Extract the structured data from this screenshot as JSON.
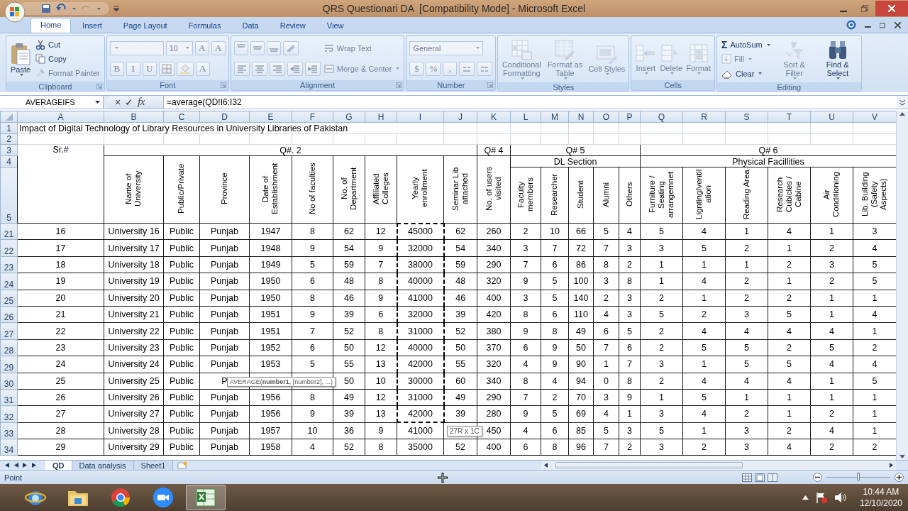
{
  "window": {
    "title": "QRS Questionari DA  [Compatibility Mode] - Microsoft Excel"
  },
  "ribbon": {
    "tabs": [
      {
        "label": "Home",
        "selected": true
      },
      {
        "label": "Insert",
        "selected": false
      },
      {
        "label": "Page Layout",
        "selected": false
      },
      {
        "label": "Formulas",
        "selected": false
      },
      {
        "label": "Data",
        "selected": false
      },
      {
        "label": "Review",
        "selected": false
      },
      {
        "label": "View",
        "selected": false
      }
    ],
    "groups": [
      {
        "label": "Clipboard",
        "launcher": true,
        "columns": [
          [
            {
              "kind": "large",
              "label": "Paste",
              "disabled": false,
              "dropdown": true
            }
          ],
          [
            {
              "kind": "small",
              "label": "Cut",
              "disabled": false
            },
            {
              "kind": "small",
              "label": "Copy",
              "disabled": false
            },
            {
              "kind": "small",
              "label": "Format Painter",
              "disabled": true
            }
          ]
        ]
      },
      {
        "label": "Font",
        "launcher": true,
        "columns": [
          [
            {
              "kind": "toolrow",
              "tools": [
                {
                  "kind": "field",
                  "disabled": true
                },
                {
                  "kind": "field",
                  "value": "10",
                  "disabled": true
                },
                {
                  "kind": "button",
                  "label": "A",
                  "disabled": true
                },
                {
                  "kind": "button",
                  "label": "A",
                  "disabled": true
                }
              ]
            },
            {
              "kind": "toolrow",
              "tools": [
                {
                  "kind": "button",
                  "label": "B",
                  "disabled": true
                },
                {
                  "kind": "button",
                  "label": "I",
                  "disabled": true
                },
                {
                  "kind": "button",
                  "label": "U",
                  "disabled": true
                },
                {
                  "kind": "button",
                  "disabled": true
                },
                {
                  "kind": "button",
                  "disabled": true
                },
                {
                  "kind": "button",
                  "label": "A",
                  "disabled": true
                }
              ]
            }
          ]
        ]
      },
      {
        "label": "Alignment",
        "launcher": true,
        "columns": [
          [
            {
              "kind": "toolrow",
              "tools": [
                {
                  "kind": "button",
                  "disabled": true
                },
                {
                  "kind": "button",
                  "disabled": true
                },
                {
                  "kind": "button",
                  "disabled": true
                },
                {
                  "kind": "button",
                  "disabled": true
                }
              ]
            },
            {
              "kind": "toolrow",
              "tools": [
                {
                  "kind": "button",
                  "disabled": true
                },
                {
                  "kind": "button",
                  "disabled": true
                },
                {
                  "kind": "button",
                  "disabled": true
                },
                {
                  "kind": "button",
                  "disabled": true
                },
                {
                  "kind": "button",
                  "disabled": true
                }
              ]
            }
          ],
          [
            {
              "kind": "small",
              "label": "Wrap Text",
              "disabled": true
            },
            {
              "kind": "small",
              "label": "Merge & Center",
              "disabled": true,
              "dropdown": true
            }
          ]
        ]
      },
      {
        "label": "Number",
        "launcher": true,
        "columns": [
          [
            {
              "kind": "toolrow",
              "tools": [
                {
                  "kind": "field",
                  "value": "General",
                  "disabled": true
                }
              ]
            },
            {
              "kind": "toolrow",
              "tools": [
                {
                  "kind": "button",
                  "label": "$",
                  "disabled": true
                },
                {
                  "kind": "button",
                  "label": "%",
                  "disabled": true
                },
                {
                  "kind": "button",
                  "label": ",",
                  "disabled": true
                },
                {
                  "kind": "button",
                  "disabled": true
                },
                {
                  "kind": "button",
                  "disabled": true
                }
              ]
            }
          ]
        ]
      },
      {
        "label": "Styles",
        "launcher": false,
        "columns": [
          [
            {
              "kind": "large",
              "label": "Conditional Formatting",
              "disabled": true,
              "dropdown": true
            }
          ],
          [
            {
              "kind": "large",
              "label": "Format as Table",
              "disabled": true,
              "dropdown": true
            }
          ],
          [
            {
              "kind": "large",
              "label": "Cell Styles",
              "disabled": true,
              "dropdown": true
            }
          ]
        ]
      },
      {
        "label": "Cells",
        "launcher": false,
        "columns": [
          [
            {
              "kind": "large",
              "label": "Insert",
              "disabled": true,
              "dropdown": true
            }
          ],
          [
            {
              "kind": "large",
              "label": "Delete",
              "disabled": true,
              "dropdown": true
            }
          ],
          [
            {
              "kind": "large",
              "label": "Format",
              "disabled": true,
              "dropdown": true
            }
          ]
        ]
      },
      {
        "label": "Editing",
        "launcher": false,
        "columns": [
          [
            {
              "kind": "small",
              "glyph": "Σ",
              "label": "AutoSum",
              "disabled": false,
              "dropdown": true
            },
            {
              "kind": "small",
              "label": "Fill",
              "disabled": true,
              "dropdown": true
            },
            {
              "kind": "small",
              "label": "Clear",
              "disabled": false,
              "dropdown": true
            }
          ],
          [
            {
              "kind": "large",
              "label": "Sort & Filter",
              "disabled": true,
              "dropdown": true
            }
          ],
          [
            {
              "kind": "large",
              "label": "Find & Select",
              "disabled": false,
              "dropdown": true
            }
          ]
        ]
      }
    ]
  },
  "formula_bar": {
    "name_box": "AVERAGEIFS",
    "cancel": "×",
    "enter": "✓",
    "function": "fx",
    "formula": "=average(QD!I6:I32"
  },
  "sheet": {
    "columns": [
      "A",
      "B",
      "C",
      "D",
      "E",
      "F",
      "G",
      "H",
      "I",
      "J",
      "K",
      "L",
      "M",
      "N",
      "O",
      "P",
      "Q",
      "R",
      "S",
      "T",
      "U",
      "V"
    ],
    "header_rows": [
      "1",
      "2",
      "3",
      "4",
      "5"
    ],
    "title": "Impact of Digital Technology of Library Resources in University Libraries of Pakistan",
    "groups": [
      {
        "label": "Sr.#"
      },
      {
        "label": "Q#. 2"
      },
      {
        "label": "Q# 4"
      },
      {
        "label": "Q# 5"
      },
      {
        "label": "Q# 6"
      }
    ],
    "subgroups": [
      {
        "label": "DL Section"
      },
      {
        "label": "Physical Facillities"
      }
    ],
    "column_headings": [
      "Name of University",
      "Public/Private",
      "Province",
      "Date of Establishment",
      "No of faculties",
      "No. of Department",
      "Affiliated Colleges",
      "Yearly enrollment",
      "Seminar Lib attached",
      "No. of users visited",
      "Faculty members",
      "Researcher",
      "Student",
      "Alumni",
      "Others",
      "Furniture / Seating arrangemnet",
      "Lignting/ventil ation",
      "Reading Area",
      "Research Cubicles / Cabine",
      "Air Conditioning",
      "Lib. Building (Safety Aspects)"
    ],
    "rows": [
      {
        "header": "21",
        "referenced": true,
        "cells": [
          "16",
          "University 16",
          "Public",
          "Punjab",
          "1947",
          "8",
          "62",
          "12",
          "45000",
          "62",
          "260",
          "2",
          "10",
          "66",
          "5",
          "4",
          "5",
          "4",
          "1",
          "4",
          "1",
          "3"
        ]
      },
      {
        "header": "22",
        "referenced": true,
        "cells": [
          "17",
          "University 17",
          "Public",
          "Punjab",
          "1948",
          "9",
          "54",
          "9",
          "32000",
          "54",
          "340",
          "3",
          "7",
          "72",
          "7",
          "3",
          "3",
          "5",
          "2",
          "1",
          "2",
          "4"
        ]
      },
      {
        "header": "23",
        "referenced": true,
        "cells": [
          "18",
          "University 18",
          "Public",
          "Punjab",
          "1949",
          "5",
          "59",
          "7",
          "38000",
          "59",
          "290",
          "7",
          "6",
          "86",
          "8",
          "2",
          "1",
          "1",
          "1",
          "2",
          "3",
          "5"
        ]
      },
      {
        "header": "24",
        "referenced": true,
        "cells": [
          "19",
          "University 19",
          "Public",
          "Punjab",
          "1950",
          "6",
          "48",
          "8",
          "40000",
          "48",
          "320",
          "9",
          "5",
          "100",
          "3",
          "8",
          "1",
          "4",
          "2",
          "1",
          "2",
          "5"
        ]
      },
      {
        "header": "25",
        "referenced": true,
        "cells": [
          "20",
          "University 20",
          "Public",
          "Punjab",
          "1950",
          "8",
          "46",
          "9",
          "41000",
          "46",
          "400",
          "3",
          "5",
          "140",
          "2",
          "3",
          "2",
          "1",
          "2",
          "2",
          "1",
          "1"
        ]
      },
      {
        "header": "26",
        "referenced": true,
        "cells": [
          "21",
          "University 21",
          "Public",
          "Punjab",
          "1951",
          "9",
          "39",
          "6",
          "32000",
          "39",
          "420",
          "8",
          "6",
          "110",
          "4",
          "3",
          "5",
          "2",
          "3",
          "5",
          "1",
          "4"
        ]
      },
      {
        "header": "27",
        "referenced": true,
        "cells": [
          "22",
          "University 22",
          "Public",
          "Punjab",
          "1951",
          "7",
          "52",
          "8",
          "31000",
          "52",
          "380",
          "9",
          "8",
          "49",
          "6",
          "5",
          "2",
          "4",
          "4",
          "4",
          "4",
          "1"
        ]
      },
      {
        "header": "28",
        "referenced": true,
        "cells": [
          "23",
          "University 23",
          "Public",
          "Punjab",
          "1952",
          "6",
          "50",
          "12",
          "40000",
          "50",
          "370",
          "6",
          "9",
          "50",
          "7",
          "6",
          "2",
          "5",
          "5",
          "2",
          "5",
          "2"
        ]
      },
      {
        "header": "29",
        "referenced": true,
        "cells": [
          "24",
          "University 24",
          "Public",
          "Punjab",
          "1953",
          "5",
          "55",
          "13",
          "42000",
          "55",
          "320",
          "4",
          "9",
          "90",
          "1",
          "7",
          "3",
          "1",
          "5",
          "5",
          "4",
          "4"
        ]
      },
      {
        "header": "30",
        "referenced": true,
        "cells": [
          "25",
          "University 25",
          "Public",
          "P",
          null,
          null,
          "50",
          "10",
          "30000",
          "60",
          "340",
          "8",
          "4",
          "94",
          "0",
          "8",
          "2",
          "4",
          "4",
          "4",
          "1",
          "5"
        ]
      },
      {
        "header": "31",
        "referenced": true,
        "cells": [
          "26",
          "University 26",
          "Public",
          "Punjab",
          "1956",
          "8",
          "49",
          "12",
          "31000",
          "49",
          "290",
          "7",
          "2",
          "70",
          "3",
          "9",
          "1",
          "5",
          "1",
          "1",
          "1",
          "1"
        ]
      },
      {
        "header": "32",
        "referenced": true,
        "cells": [
          "27",
          "University 27",
          "Public",
          "Punjab",
          "1956",
          "9",
          "39",
          "13",
          "42000",
          "39",
          "280",
          "9",
          "5",
          "69",
          "4",
          "1",
          "3",
          "4",
          "2",
          "1",
          "2",
          "1"
        ]
      },
      {
        "header": "33",
        "referenced": false,
        "cells": [
          "28",
          "University 28",
          "Public",
          "Punjab",
          "1957",
          "10",
          "36",
          "9",
          "41000",
          null,
          "450",
          "4",
          "6",
          "85",
          "5",
          "3",
          "5",
          "1",
          "3",
          "2",
          "4",
          "1"
        ]
      },
      {
        "header": "34",
        "referenced": false,
        "cells": [
          "29",
          "University 29",
          "Public",
          "Punjab",
          "1958",
          "4",
          "52",
          "8",
          "35000",
          "52",
          "400",
          "6",
          "8",
          "96",
          "7",
          "2",
          "3",
          "2",
          "3",
          "4",
          "2",
          "2"
        ]
      }
    ],
    "formula_tooltip": "AVERAGE(**number1**, [number2], ...)",
    "selection_tooltip": "27R x 1C"
  },
  "sheet_tabs": [
    {
      "label": "QD",
      "selected": true
    },
    {
      "label": "Data analysis",
      "selected": false
    },
    {
      "label": "Sheet1",
      "selected": false
    }
  ],
  "status_bar": {
    "mode": "Point",
    "zoom": {
      "level": 0.5
    }
  },
  "taskbar": {
    "apps": [
      {
        "active": false
      },
      {
        "active": false
      },
      {
        "active": false
      },
      {
        "active": false
      },
      {
        "active": true
      }
    ],
    "time": "10:44 AM",
    "date": "12/10/2020"
  }
}
